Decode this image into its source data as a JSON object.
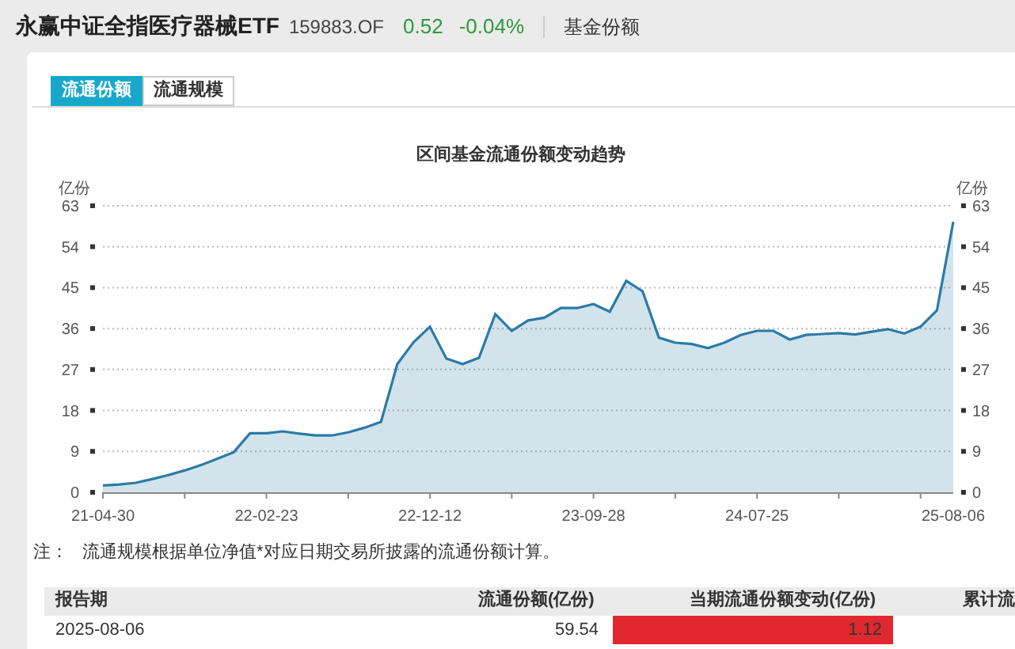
{
  "header": {
    "fund_name": "永赢中证全指医疗器械ETF",
    "code": "159883.OF",
    "price": "0.52",
    "change": "-0.04%",
    "section": "基金份额"
  },
  "tabs": [
    {
      "label": "流通份额",
      "selected": true
    },
    {
      "label": "流通规模",
      "selected": false
    }
  ],
  "chart": {
    "chart_data": {
      "type": "area",
      "title": "区间基金流通份额变动趋势",
      "ylabel": "亿份",
      "categories": [
        "21-04-30",
        null,
        null,
        null,
        null,
        null,
        null,
        null,
        null,
        null,
        "22-02-23",
        null,
        null,
        null,
        null,
        null,
        null,
        null,
        null,
        null,
        "22-12-12",
        null,
        null,
        null,
        null,
        null,
        null,
        null,
        null,
        null,
        "23-09-28",
        null,
        null,
        null,
        null,
        null,
        null,
        null,
        null,
        null,
        "24-07-25",
        null,
        null,
        null,
        null,
        null,
        null,
        null,
        null,
        null,
        null,
        null,
        "25-08-06"
      ],
      "series": [
        {
          "color": "#2b7ba6",
          "values": [
            1.5,
            1.7,
            2.1,
            2.9,
            3.8,
            4.8,
            6.0,
            7.4,
            8.8,
            13.0,
            13.0,
            13.4,
            12.9,
            12.5,
            12.5,
            13.2,
            14.2,
            15.5,
            28.2,
            33,
            36.4,
            29.4,
            28.2,
            29.6,
            39.2,
            35.5,
            37.8,
            38.4,
            40.5,
            40.5,
            41.4,
            39.7,
            46.5,
            44.2,
            34.0,
            32.9,
            32.6,
            31.7,
            32.9,
            34.6,
            35.5,
            35.5,
            33.6,
            34.6,
            34.8,
            35,
            34.7,
            35.3,
            35.9,
            34.9,
            36.4,
            40,
            59.5
          ]
        }
      ],
      "grid": true,
      "ylim": [
        0,
        63
      ],
      "yticks": [
        0,
        9,
        18,
        27,
        36,
        45,
        54,
        63
      ]
    },
    "left_axis": {
      "ticks": [
        "63",
        "54",
        "45",
        "36",
        "27",
        "18",
        "9",
        "0"
      ]
    },
    "right_axis": {
      "unit": "亿份",
      "ticks": [
        "63",
        "54",
        "45",
        "36",
        "27",
        "18",
        "9",
        "0"
      ]
    }
  },
  "note": {
    "label": "注：",
    "text": "流通规模根据单位净值*对应日期交易所披露的流通份额计算。"
  },
  "table": {
    "columns": [
      "报告期",
      "流通份额(亿份)",
      "当期流通份额变动(亿份)",
      "累计流"
    ],
    "rows": [
      {
        "date": "2025-08-06",
        "shares": "59.54",
        "change": "1.12",
        "color": "#e0282e"
      }
    ]
  }
}
